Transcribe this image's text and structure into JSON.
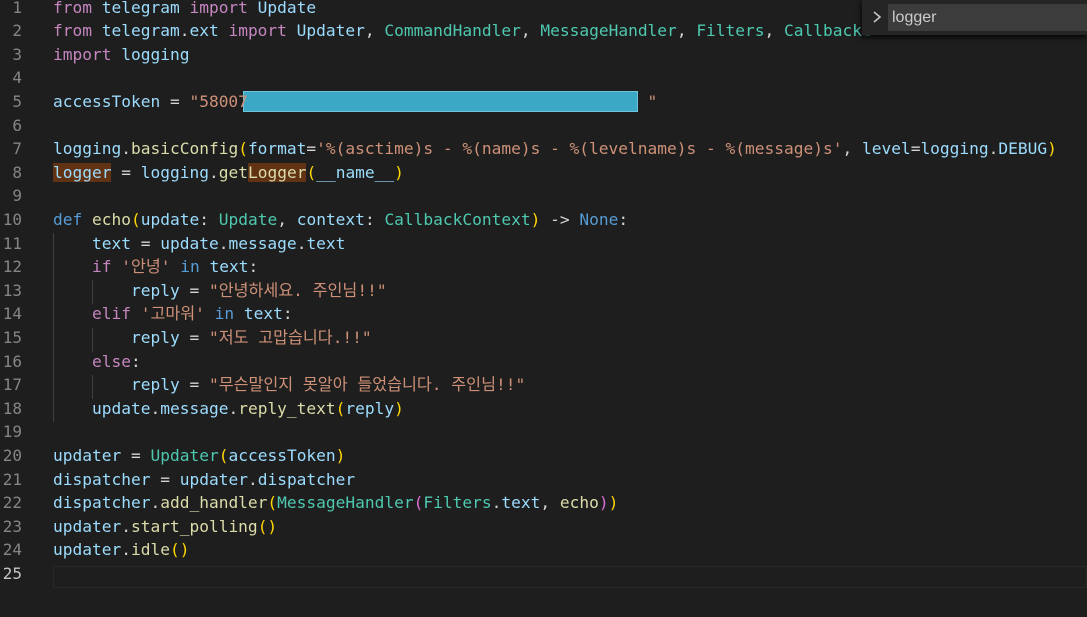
{
  "find_widget": {
    "query": "logger"
  },
  "editor": {
    "active_line": 25,
    "lines": [
      {
        "n": "1",
        "tokens": [
          {
            "t": "from",
            "c": "kw"
          },
          {
            "t": " telegram ",
            "c": "var"
          },
          {
            "t": "import",
            "c": "kw"
          },
          {
            "t": " Update",
            "c": "var"
          }
        ]
      },
      {
        "n": "2",
        "tokens": [
          {
            "t": "from",
            "c": "kw"
          },
          {
            "t": " telegram",
            "c": "var"
          },
          {
            "t": ".",
            "c": "op"
          },
          {
            "t": "ext",
            "c": "var"
          },
          {
            "t": " import",
            "c": "kw"
          },
          {
            "t": " Updater",
            "c": "var"
          },
          {
            "t": ", ",
            "c": "op"
          },
          {
            "t": "CommandHandler",
            "c": "ty"
          },
          {
            "t": ", ",
            "c": "op"
          },
          {
            "t": "MessageHandler",
            "c": "ty"
          },
          {
            "t": ", ",
            "c": "op"
          },
          {
            "t": "Filters",
            "c": "ty"
          },
          {
            "t": ", ",
            "c": "op"
          },
          {
            "t": "CallbackC",
            "c": "ty"
          }
        ]
      },
      {
        "n": "3",
        "tokens": [
          {
            "t": "import",
            "c": "kw"
          },
          {
            "t": " logging",
            "c": "var"
          }
        ]
      },
      {
        "n": "4",
        "tokens": []
      },
      {
        "n": "5",
        "tokens": [
          {
            "t": "accessToken",
            "c": "var"
          },
          {
            "t": " = ",
            "c": "op"
          },
          {
            "t": "\"58007",
            "c": "str"
          },
          {
            "t": "                                         ",
            "c": "str"
          },
          {
            "t": "\"",
            "c": "str"
          }
        ]
      },
      {
        "n": "6",
        "tokens": []
      },
      {
        "n": "7",
        "tokens": [
          {
            "t": "logging",
            "c": "var"
          },
          {
            "t": ".",
            "c": "op"
          },
          {
            "t": "basicConfig",
            "c": "fn"
          },
          {
            "t": "(",
            "c": "br"
          },
          {
            "t": "format",
            "c": "var"
          },
          {
            "t": "=",
            "c": "op"
          },
          {
            "t": "'%(asctime)s - %(name)s - %(levelname)s - %(message)s'",
            "c": "str"
          },
          {
            "t": ", ",
            "c": "op"
          },
          {
            "t": "level",
            "c": "var"
          },
          {
            "t": "=",
            "c": "op"
          },
          {
            "t": "logging",
            "c": "var"
          },
          {
            "t": ".",
            "c": "op"
          },
          {
            "t": "DEBUG",
            "c": "var"
          },
          {
            "t": ")",
            "c": "br"
          }
        ]
      },
      {
        "n": "8",
        "tokens": [
          {
            "t": "logger",
            "c": "var hl"
          },
          {
            "t": " = ",
            "c": "op"
          },
          {
            "t": "logging",
            "c": "var"
          },
          {
            "t": ".",
            "c": "op"
          },
          {
            "t": "get",
            "c": "fn"
          },
          {
            "t": "Logger",
            "c": "fn hl"
          },
          {
            "t": "(",
            "c": "br"
          },
          {
            "t": "__name__",
            "c": "var"
          },
          {
            "t": ")",
            "c": "br"
          }
        ]
      },
      {
        "n": "9",
        "tokens": []
      },
      {
        "n": "10",
        "tokens": [
          {
            "t": "def",
            "c": "kb"
          },
          {
            "t": " echo",
            "c": "fn"
          },
          {
            "t": "(",
            "c": "br"
          },
          {
            "t": "update",
            "c": "var"
          },
          {
            "t": ": ",
            "c": "op"
          },
          {
            "t": "Update",
            "c": "ty"
          },
          {
            "t": ", ",
            "c": "op"
          },
          {
            "t": "context",
            "c": "var"
          },
          {
            "t": ": ",
            "c": "op"
          },
          {
            "t": "CallbackContext",
            "c": "ty"
          },
          {
            "t": ")",
            "c": "br"
          },
          {
            "t": " -> ",
            "c": "op"
          },
          {
            "t": "None",
            "c": "kb"
          },
          {
            "t": ":",
            "c": "op"
          }
        ]
      },
      {
        "n": "11",
        "tokens": [
          {
            "t": "    ",
            "c": "op"
          },
          {
            "t": "text",
            "c": "var"
          },
          {
            "t": " = ",
            "c": "op"
          },
          {
            "t": "update",
            "c": "var"
          },
          {
            "t": ".",
            "c": "op"
          },
          {
            "t": "message",
            "c": "var"
          },
          {
            "t": ".",
            "c": "op"
          },
          {
            "t": "text",
            "c": "var"
          }
        ]
      },
      {
        "n": "12",
        "tokens": [
          {
            "t": "    ",
            "c": "op"
          },
          {
            "t": "if",
            "c": "kw"
          },
          {
            "t": " '안녕'",
            "c": "str"
          },
          {
            "t": " in",
            "c": "kb"
          },
          {
            "t": " text",
            "c": "var"
          },
          {
            "t": ":",
            "c": "op"
          }
        ]
      },
      {
        "n": "13",
        "tokens": [
          {
            "t": "        ",
            "c": "op"
          },
          {
            "t": "reply",
            "c": "var"
          },
          {
            "t": " = ",
            "c": "op"
          },
          {
            "t": "\"안녕하세요. 주인님!!\"",
            "c": "str"
          }
        ]
      },
      {
        "n": "14",
        "tokens": [
          {
            "t": "    ",
            "c": "op"
          },
          {
            "t": "elif",
            "c": "kw"
          },
          {
            "t": " '고마워'",
            "c": "str"
          },
          {
            "t": " in",
            "c": "kb"
          },
          {
            "t": " text",
            "c": "var"
          },
          {
            "t": ":",
            "c": "op"
          }
        ]
      },
      {
        "n": "15",
        "tokens": [
          {
            "t": "        ",
            "c": "op"
          },
          {
            "t": "reply",
            "c": "var"
          },
          {
            "t": " = ",
            "c": "op"
          },
          {
            "t": "\"저도 고맙습니다.!!\"",
            "c": "str"
          }
        ]
      },
      {
        "n": "16",
        "tokens": [
          {
            "t": "    ",
            "c": "op"
          },
          {
            "t": "else",
            "c": "kw"
          },
          {
            "t": ":",
            "c": "op"
          }
        ]
      },
      {
        "n": "17",
        "tokens": [
          {
            "t": "        ",
            "c": "op"
          },
          {
            "t": "reply",
            "c": "var"
          },
          {
            "t": " = ",
            "c": "op"
          },
          {
            "t": "\"무슨말인지 못알아 들었습니다. 주인님!!\"",
            "c": "str"
          }
        ]
      },
      {
        "n": "18",
        "tokens": [
          {
            "t": "    ",
            "c": "op"
          },
          {
            "t": "update",
            "c": "var"
          },
          {
            "t": ".",
            "c": "op"
          },
          {
            "t": "message",
            "c": "var"
          },
          {
            "t": ".",
            "c": "op"
          },
          {
            "t": "reply_text",
            "c": "fn"
          },
          {
            "t": "(",
            "c": "br"
          },
          {
            "t": "reply",
            "c": "var"
          },
          {
            "t": ")",
            "c": "br"
          }
        ]
      },
      {
        "n": "19",
        "tokens": []
      },
      {
        "n": "20",
        "tokens": [
          {
            "t": "updater",
            "c": "var"
          },
          {
            "t": " = ",
            "c": "op"
          },
          {
            "t": "Updater",
            "c": "ty"
          },
          {
            "t": "(",
            "c": "br"
          },
          {
            "t": "accessToken",
            "c": "var"
          },
          {
            "t": ")",
            "c": "br"
          }
        ]
      },
      {
        "n": "21",
        "tokens": [
          {
            "t": "dispatcher",
            "c": "var"
          },
          {
            "t": " = ",
            "c": "op"
          },
          {
            "t": "updater",
            "c": "var"
          },
          {
            "t": ".",
            "c": "op"
          },
          {
            "t": "dispatcher",
            "c": "var"
          }
        ]
      },
      {
        "n": "22",
        "tokens": [
          {
            "t": "dispatcher",
            "c": "var"
          },
          {
            "t": ".",
            "c": "op"
          },
          {
            "t": "add_handler",
            "c": "fn"
          },
          {
            "t": "(",
            "c": "br"
          },
          {
            "t": "MessageHandler",
            "c": "ty"
          },
          {
            "t": "(",
            "c": "br2"
          },
          {
            "t": "Filters",
            "c": "ty"
          },
          {
            "t": ".",
            "c": "op"
          },
          {
            "t": "text",
            "c": "var"
          },
          {
            "t": ", ",
            "c": "op"
          },
          {
            "t": "echo",
            "c": "fn"
          },
          {
            "t": ")",
            "c": "br2"
          },
          {
            "t": ")",
            "c": "br"
          }
        ]
      },
      {
        "n": "23",
        "tokens": [
          {
            "t": "updater",
            "c": "var"
          },
          {
            "t": ".",
            "c": "op"
          },
          {
            "t": "start_polling",
            "c": "fn"
          },
          {
            "t": "()",
            "c": "br"
          }
        ]
      },
      {
        "n": "24",
        "tokens": [
          {
            "t": "updater",
            "c": "var"
          },
          {
            "t": ".",
            "c": "op"
          },
          {
            "t": "idle",
            "c": "fn"
          },
          {
            "t": "()",
            "c": "br"
          }
        ]
      },
      {
        "n": "25",
        "tokens": []
      }
    ]
  }
}
